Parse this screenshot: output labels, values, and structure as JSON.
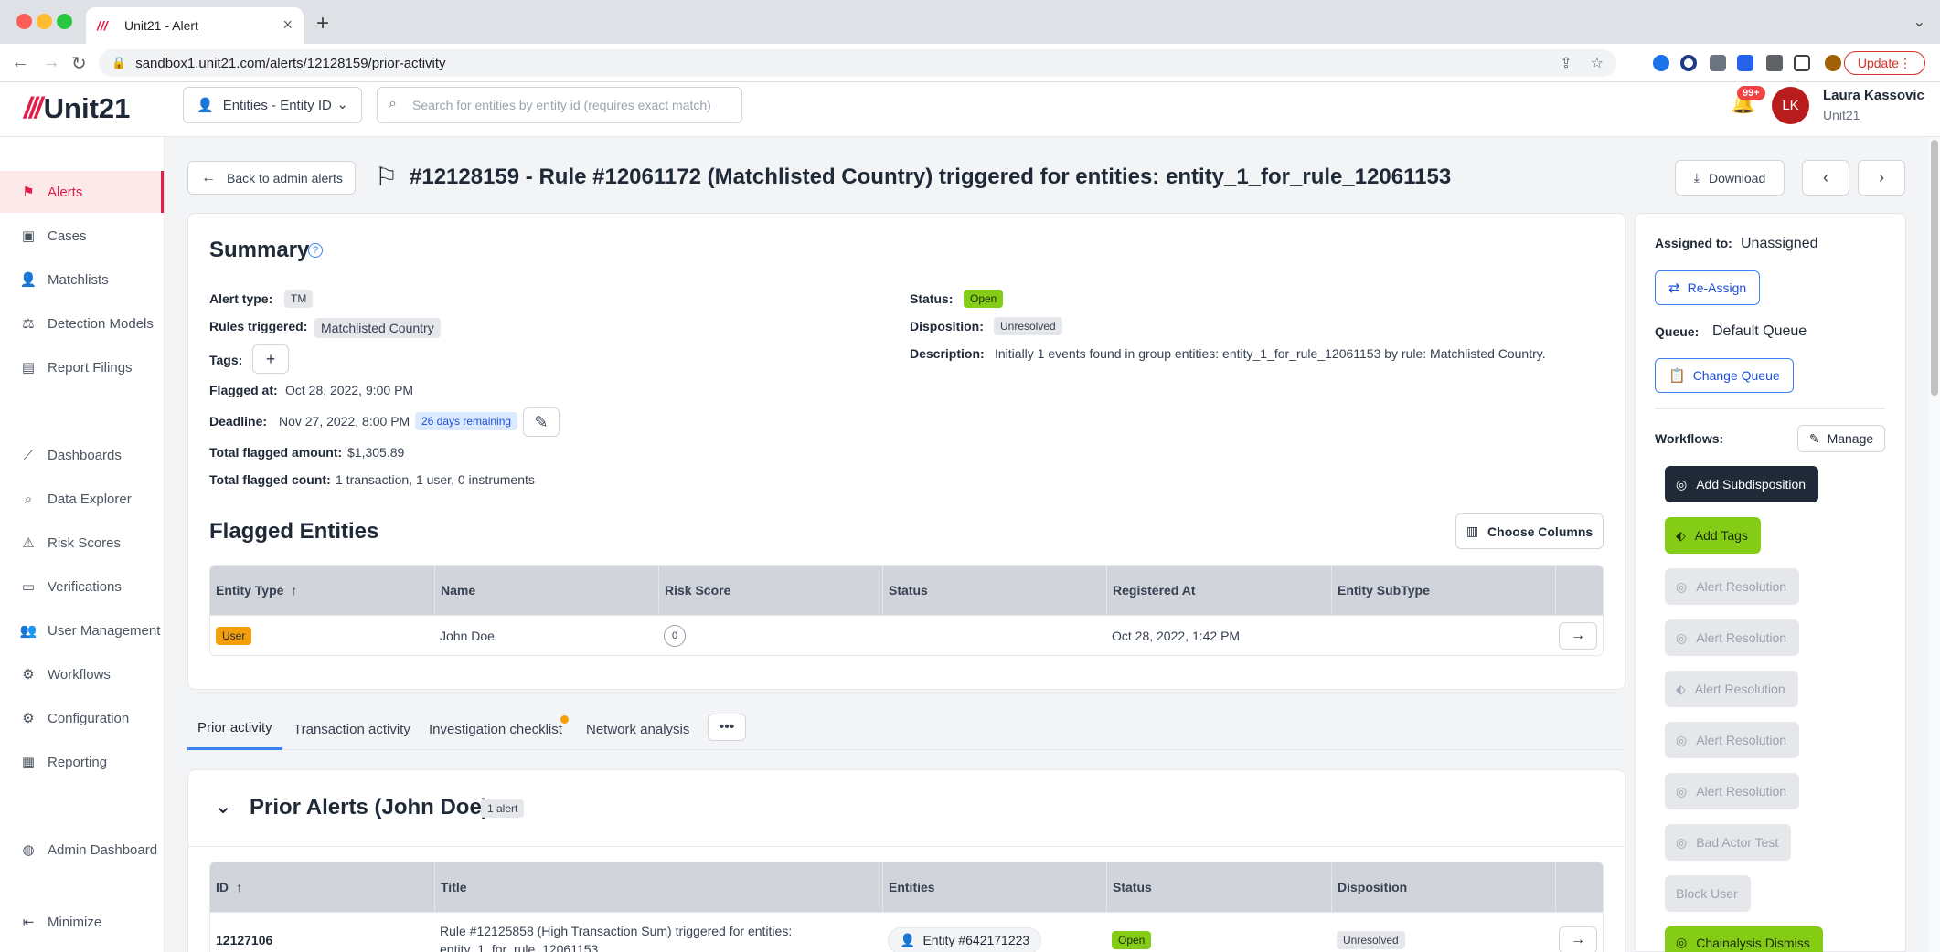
{
  "browser": {
    "tab_title": "Unit21 - Alert",
    "url": "sandbox1.unit21.com/alerts/12128159/prior-activity",
    "update_label": "Update"
  },
  "header": {
    "logo_text": "Unit21",
    "entity_selector": "Entities - Entity ID",
    "search_placeholder": "Search for entities by entity id (requires exact match)",
    "notification_count": "99+",
    "user_initials": "LK",
    "user_name": "Laura Kassovic",
    "user_org": "Unit21"
  },
  "sidebar": {
    "items": [
      {
        "label": "Alerts",
        "icon": "flag-icon",
        "active": true
      },
      {
        "label": "Cases",
        "icon": "briefcase-icon"
      },
      {
        "label": "Matchlists",
        "icon": "user-plus-icon"
      },
      {
        "label": "Detection Models",
        "icon": "scale-icon"
      },
      {
        "label": "Report Filings",
        "icon": "building-icon"
      },
      {
        "label": "Dashboards",
        "icon": "chart-line-icon"
      },
      {
        "label": "Data Explorer",
        "icon": "zoom-icon"
      },
      {
        "label": "Risk Scores",
        "icon": "warning-icon"
      },
      {
        "label": "Verifications",
        "icon": "id-card-icon"
      },
      {
        "label": "User Management",
        "icon": "users-icon"
      },
      {
        "label": "Workflows",
        "icon": "cog-icon"
      },
      {
        "label": "Configuration",
        "icon": "settings-icon"
      },
      {
        "label": "Reporting",
        "icon": "report-icon"
      },
      {
        "label": "Admin Dashboard",
        "icon": "globe-icon"
      },
      {
        "label": "Minimize",
        "icon": "collapse-icon"
      }
    ]
  },
  "page": {
    "back_label": "Back to admin alerts",
    "title": "#12128159 - Rule #12061172 (Matchlisted Country) triggered for entities: entity_1_for_rule_12061153",
    "download_label": "Download"
  },
  "summary": {
    "title": "Summary",
    "alert_type_label": "Alert type:",
    "alert_type": "TM",
    "rules_label": "Rules triggered:",
    "rule": "Matchlisted Country",
    "tags_label": "Tags:",
    "flagged_at_label": "Flagged at:",
    "flagged_at": "Oct 28, 2022, 9:00 PM",
    "deadline_label": "Deadline:",
    "deadline": "Nov 27, 2022, 8:00 PM",
    "days_remaining": "26 days remaining",
    "amount_label": "Total flagged amount:",
    "amount": "$1,305.89",
    "count_label": "Total flagged count:",
    "count": "1 transaction, 1 user, 0 instruments",
    "status_label": "Status:",
    "status": "Open",
    "disposition_label": "Disposition:",
    "disposition": "Unresolved",
    "description_label": "Description:",
    "description": "Initially 1 events found in group entities: entity_1_for_rule_12061153 by rule: Matchlisted Country."
  },
  "flagged": {
    "title": "Flagged Entities",
    "choose_columns": "Choose Columns",
    "columns": [
      "Entity Type",
      "Name",
      "Risk Score",
      "Status",
      "Registered At",
      "Entity SubType"
    ],
    "row": {
      "type": "User",
      "name": "John Doe",
      "risk": "0",
      "status": "",
      "registered": "Oct 28, 2022, 1:42 PM",
      "subtype": ""
    }
  },
  "tabs": [
    "Prior activity",
    "Transaction activity",
    "Investigation checklist",
    "Network analysis"
  ],
  "prior": {
    "title": "Prior Alerts (John Doe)",
    "count": "1 alert",
    "columns": [
      "ID",
      "Title",
      "Entities",
      "Status",
      "Disposition"
    ],
    "row": {
      "id": "12127106",
      "title_line1": "Rule #12125858 (High Transaction Sum) triggered for entities:",
      "title_line2": "entity_1_for_rule_12061153",
      "entity": "Entity #642171223",
      "status": "Open",
      "disposition": "Unresolved"
    }
  },
  "panel": {
    "assigned_label": "Assigned to:",
    "assigned": "Unassigned",
    "reassign": "Re-Assign",
    "queue_label": "Queue:",
    "queue": "Default Queue",
    "change_queue": "Change Queue",
    "workflows_label": "Workflows:",
    "manage": "Manage",
    "workflows": [
      {
        "label": "Add Subdisposition",
        "style": "dark"
      },
      {
        "label": "Add Tags",
        "style": "green"
      },
      {
        "label": "Alert Resolution",
        "style": "dis"
      },
      {
        "label": "Alert Resolution",
        "style": "dis"
      },
      {
        "label": "Alert Resolution",
        "style": "dis"
      },
      {
        "label": "Alert Resolution",
        "style": "dis"
      },
      {
        "label": "Alert Resolution",
        "style": "dis"
      },
      {
        "label": "Bad Actor Test",
        "style": "dis"
      },
      {
        "label": "Block User",
        "style": "dis"
      },
      {
        "label": "Chainalysis Dismiss",
        "style": "green"
      }
    ]
  },
  "colors": {
    "accent": "#e11d48",
    "link": "#3b82f6",
    "green": "#84cc16",
    "amber": "#f59e0b"
  }
}
